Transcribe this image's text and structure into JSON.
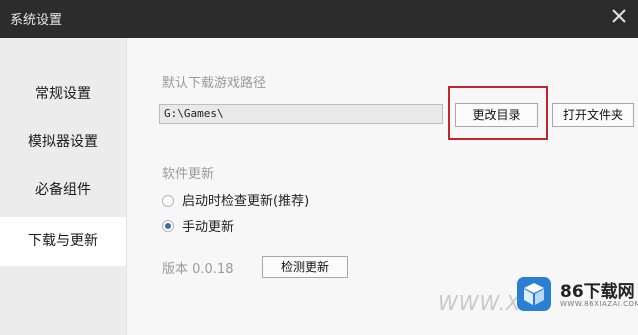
{
  "window": {
    "title": "系统设置",
    "close_icon": "close-icon"
  },
  "sidebar": {
    "items": [
      {
        "label": "常规设置",
        "active": false
      },
      {
        "label": "模拟器设置",
        "active": false
      },
      {
        "label": "必备组件",
        "active": false
      },
      {
        "label": "下载与更新",
        "active": true
      }
    ]
  },
  "download": {
    "section_label": "默认下载游戏路径",
    "path_value": "G:\\Games\\",
    "change_dir_label": "更改目录",
    "open_folder_label": "打开文件夹"
  },
  "update": {
    "section_label": "软件更新",
    "options": [
      {
        "label": "启动时检查更新(推荐)",
        "checked": false
      },
      {
        "label": "手动更新",
        "checked": true
      }
    ],
    "version_label": "版本 0.0.18",
    "check_button_label": "检测更新"
  },
  "watermark": {
    "text": "WWW.XI",
    "logo_text": "86下载网",
    "logo_sub": "WWW.86XIAZAI.COM",
    "accent": "#2a7fd4"
  },
  "colors": {
    "highlight": "#c0272d",
    "titlebar": "#2c2c2c"
  }
}
